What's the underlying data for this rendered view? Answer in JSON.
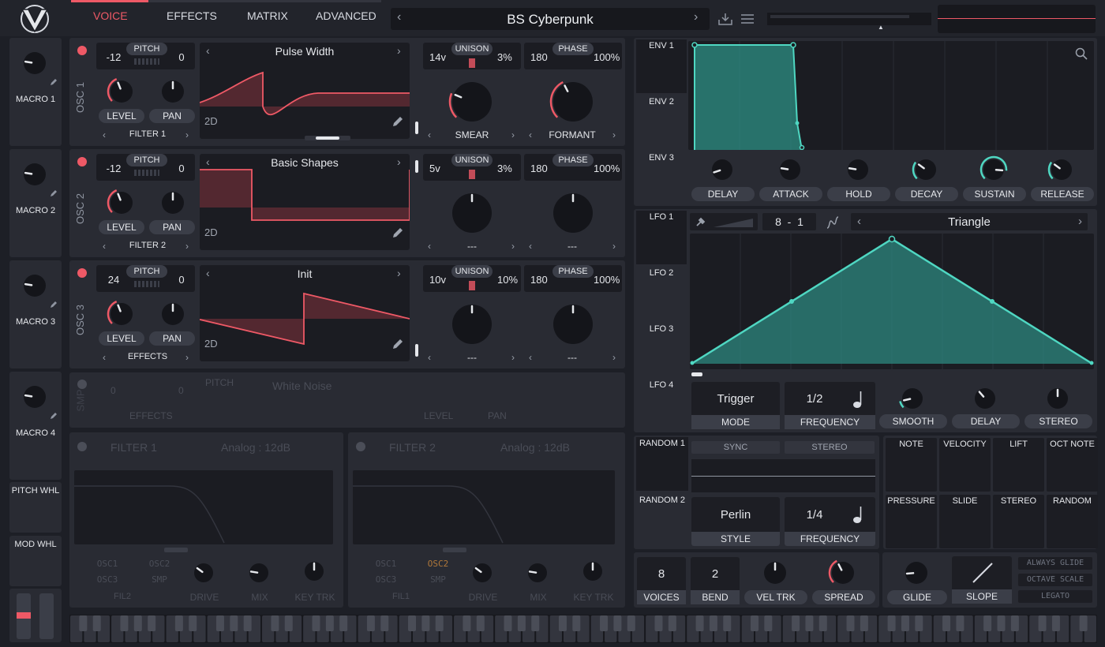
{
  "tabs": [
    "VOICE",
    "EFFECTS",
    "MATRIX",
    "ADVANCED"
  ],
  "preset": {
    "name": "BS Cyberpunk"
  },
  "macros": [
    "MACRO 1",
    "MACRO 2",
    "MACRO 3",
    "MACRO 4"
  ],
  "wheels": {
    "pitch": "PITCH WHL",
    "mod": "MOD WHL"
  },
  "osc": [
    {
      "name": "OSC 1",
      "pitch_left": "-12",
      "pitch_label": "PITCH",
      "pitch_right": "0",
      "level": "LEVEL",
      "pan": "PAN",
      "dest": "FILTER 1",
      "wave": "Pulse Width",
      "mode": "2D",
      "voices": "14v",
      "unison": "UNISON",
      "detune": "3%",
      "phase_left": "180",
      "phase": "PHASE",
      "phase_right": "100%",
      "k1": "SMEAR",
      "k2": "FORMANT"
    },
    {
      "name": "OSC 2",
      "pitch_left": "-12",
      "pitch_label": "PITCH",
      "pitch_right": "0",
      "level": "LEVEL",
      "pan": "PAN",
      "dest": "FILTER 2",
      "wave": "Basic Shapes",
      "mode": "2D",
      "voices": "5v",
      "unison": "UNISON",
      "detune": "3%",
      "phase_left": "180",
      "phase": "PHASE",
      "phase_right": "100%",
      "k1": "---",
      "k2": "---"
    },
    {
      "name": "OSC 3",
      "pitch_left": "24",
      "pitch_label": "PITCH",
      "pitch_right": "0",
      "level": "LEVEL",
      "pan": "PAN",
      "dest": "EFFECTS",
      "wave": "Init",
      "mode": "2D",
      "voices": "10v",
      "unison": "UNISON",
      "detune": "10%",
      "phase_left": "180",
      "phase": "PHASE",
      "phase_right": "100%",
      "k1": "---",
      "k2": "---"
    }
  ],
  "smp": {
    "name": "SMP",
    "pitch_left": "0",
    "pitch_label": "PITCH",
    "pitch_right": "0",
    "sample": "White Noise",
    "dest": "EFFECTS",
    "level": "LEVEL",
    "pan": "PAN"
  },
  "filters": [
    {
      "name": "FILTER 1",
      "model": "Analog : 12dB",
      "src": [
        "OSC1",
        "OSC2",
        "OSC3",
        "SMP"
      ],
      "route": "FIL2",
      "k": [
        "DRIVE",
        "MIX",
        "KEY TRK"
      ]
    },
    {
      "name": "FILTER 2",
      "model": "Analog : 12dB",
      "src": [
        "OSC1",
        "OSC2",
        "OSC3",
        "SMP"
      ],
      "route": "FIL1",
      "k": [
        "DRIVE",
        "MIX",
        "KEY TRK"
      ]
    }
  ],
  "env": {
    "tabs": [
      "ENV 1",
      "ENV 2",
      "ENV 3"
    ],
    "knobs": [
      "DELAY",
      "ATTACK",
      "HOLD",
      "DECAY",
      "SUSTAIN",
      "RELEASE"
    ]
  },
  "lfo": {
    "tabs": [
      "LFO 1",
      "LFO 2",
      "LFO 3",
      "LFO 4"
    ],
    "grid": "8  -  1",
    "shape": "Triangle",
    "mode_val": "Trigger",
    "mode_lbl": "MODE",
    "freq_val": "1/2",
    "freq_lbl": "FREQUENCY",
    "knobs": [
      "SMOOTH",
      "DELAY",
      "STEREO"
    ]
  },
  "random": {
    "tabs": [
      "RANDOM 1",
      "RANDOM 2"
    ],
    "sync": "SYNC",
    "stereo": "STEREO",
    "style_val": "Perlin",
    "style_lbl": "STYLE",
    "freq_val": "1/4",
    "freq_lbl": "FREQUENCY"
  },
  "mod_sources": [
    "NOTE",
    "VELOCITY",
    "LIFT",
    "OCT NOTE",
    "PRESSURE",
    "SLIDE",
    "STEREO",
    "RANDOM"
  ],
  "voice": {
    "voices_val": "8",
    "voices_lbl": "VOICES",
    "bend_val": "2",
    "bend_lbl": "BEND",
    "veltrk": "VEL TRK",
    "spread": "SPREAD"
  },
  "glide": {
    "glide": "GLIDE",
    "slope": "SLOPE",
    "always": "ALWAYS GLIDE",
    "octave": "OCTAVE SCALE",
    "legato": "LEGATO"
  },
  "colors": {
    "accent": "#ee5966",
    "mod": "#4fd7c2",
    "panel": "#292b33",
    "bg": "#1d1f26"
  }
}
